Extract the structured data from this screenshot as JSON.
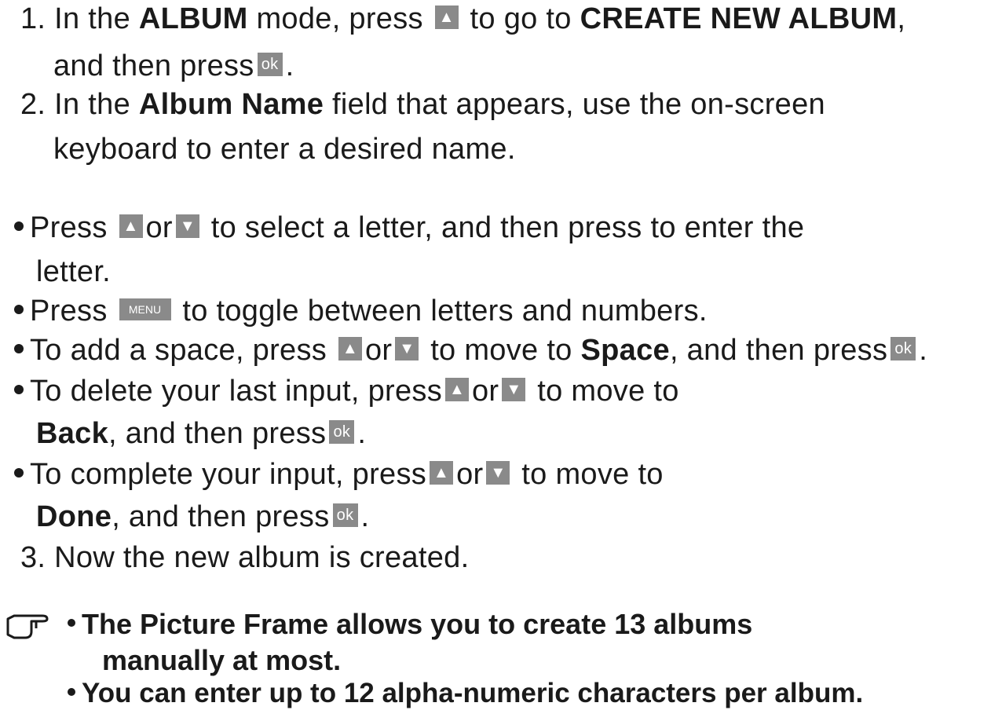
{
  "steps": {
    "s1": {
      "num": "1.",
      "a": "In the ",
      "b": "ALBUM",
      "c": " mode, press ",
      "d": " to go to ",
      "e": "CREATE NEW ALBUM",
      "f": ",",
      "g": "and then press",
      "h": "."
    },
    "s2": {
      "num": "2.",
      "a": "In the ",
      "b": "Album Name",
      "c": " field that appears, use the on-screen",
      "d": "keyboard to enter a desired name."
    },
    "s3": {
      "num": "3.",
      "a": "Now the new album is created."
    }
  },
  "bullets": {
    "b1": {
      "a": "Press ",
      "or": "or",
      "b": " to select a letter, and then press   to enter the",
      "c": "letter."
    },
    "b2": {
      "a": "Press ",
      "b": " to toggle between letters and numbers."
    },
    "b3": {
      "a": "To add a space, press ",
      "or": "or",
      "b": " to move to ",
      "c": "Space",
      "d": ", and then press",
      "e": "."
    },
    "b4": {
      "a": "To delete your last input, press",
      "or": "or",
      "b": " to move to",
      "c": "Back",
      "d": ", and then press",
      "e": "."
    },
    "b5": {
      "a": "To complete your input, press",
      "or": "or",
      "b": " to move to",
      "c": "Done",
      "d": ", and then press",
      "e": "."
    }
  },
  "keys": {
    "up": "▲",
    "down": "▼",
    "ok": "ok",
    "menu": "MENU"
  },
  "notes": [
    "The Picture Frame allows you to create 13 albums",
    "manually at most.",
    "You can enter up to 12 alpha-numeric characters per album."
  ]
}
